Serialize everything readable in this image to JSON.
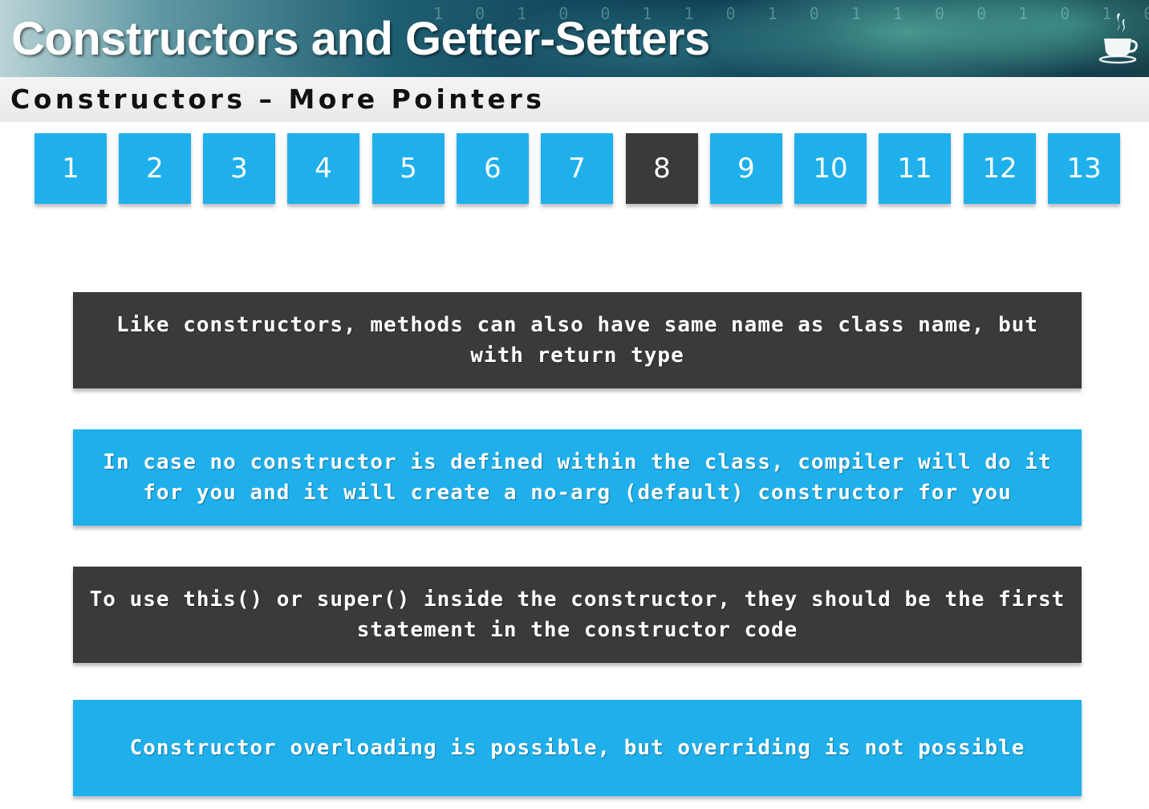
{
  "header": {
    "title": "Constructors and Getter-Setters",
    "logo_icon": "java-coffee-cup-icon",
    "background_digits": "1 0 1 0 0 1 1 0 1 0 1 1 0 0 1 0 1 0 1 0 0"
  },
  "subtitle": "Constructors – More Pointers",
  "tabs": [
    {
      "label": "1"
    },
    {
      "label": "2"
    },
    {
      "label": "3"
    },
    {
      "label": "4"
    },
    {
      "label": "5"
    },
    {
      "label": "6"
    },
    {
      "label": "7"
    },
    {
      "label": "8"
    },
    {
      "label": "9"
    },
    {
      "label": "10"
    },
    {
      "label": "11"
    },
    {
      "label": "12"
    },
    {
      "label": "13"
    }
  ],
  "active_tab": "8",
  "points": [
    "Like constructors, methods can also have same name as class name, but with return type",
    "In case no constructor is defined within the class, compiler will do it for you and it will create a no-arg (default) constructor for you",
    "To use this() or super() inside the constructor, they should be the first statement in the constructor code",
    "Constructor overloading is possible, but overriding is not possible"
  ],
  "colors": {
    "accent_blue": "#1fb0ec",
    "dark_gray": "#3a3a3a",
    "text_white": "#ffffff"
  }
}
